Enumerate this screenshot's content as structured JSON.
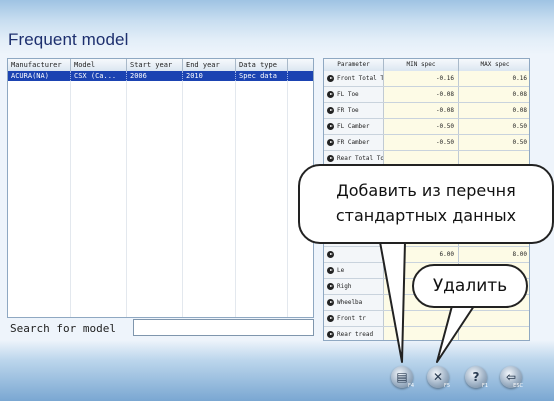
{
  "window": {
    "title": "Frequent model"
  },
  "model_table": {
    "columns": [
      "Manufacturer",
      "Model",
      "Start year",
      "End year",
      "Data type"
    ],
    "rows": [
      {
        "manufacturer": "ACURA(NA)",
        "model": "CSX (Ca...",
        "start_year": "2006",
        "end_year": "2010",
        "data_type": "Spec data"
      }
    ]
  },
  "search": {
    "label": "Search for model",
    "value": ""
  },
  "spec_table": {
    "columns": [
      "Parameter",
      "MIN spec",
      "MAX spec"
    ],
    "rows": [
      {
        "param": "Front Total To",
        "min": "-0.16",
        "max": "0.16"
      },
      {
        "param": "FL Toe",
        "min": "-0.08",
        "max": "0.08"
      },
      {
        "param": "FR Toe",
        "min": "-0.08",
        "max": "0.08"
      },
      {
        "param": "FL Camber",
        "min": "-0.50",
        "max": "0.50"
      },
      {
        "param": "FR Camber",
        "min": "-0.50",
        "max": "0.50"
      },
      {
        "param": "Rear Total To",
        "min": "",
        "max": ""
      },
      {
        "param": "",
        "min": "",
        "max": ""
      },
      {
        "param": "",
        "min": "",
        "max": ""
      },
      {
        "param": "",
        "min": "",
        "max": ""
      },
      {
        "param": "",
        "min": "",
        "max": ""
      },
      {
        "param": "",
        "min": "",
        "max": ""
      },
      {
        "param": "",
        "min": "6.00",
        "max": "8.00"
      },
      {
        "param": "Le",
        "min": "",
        "max": ""
      },
      {
        "param": "Righ",
        "min": "",
        "max": ""
      },
      {
        "param": "Wheelba",
        "min": "",
        "max": ""
      },
      {
        "param": "Front tr",
        "min": "",
        "max": ""
      },
      {
        "param": "Rear tread",
        "min": "",
        "max": ""
      }
    ]
  },
  "toolbar": {
    "buttons": [
      {
        "icon": "add-from-list-icon",
        "key": "F4"
      },
      {
        "icon": "delete-icon",
        "key": "F5"
      },
      {
        "icon": "help-icon",
        "key": "F1"
      },
      {
        "icon": "exit-icon",
        "key": "ESC"
      }
    ]
  },
  "callouts": {
    "add_line1": "Добавить из перечня",
    "add_line2": "стандартных данных",
    "delete": "Удалить"
  },
  "colors": {
    "selection": "#1b43b2",
    "title": "#1d2f6e",
    "spec_cell": "#fdfbe6"
  }
}
